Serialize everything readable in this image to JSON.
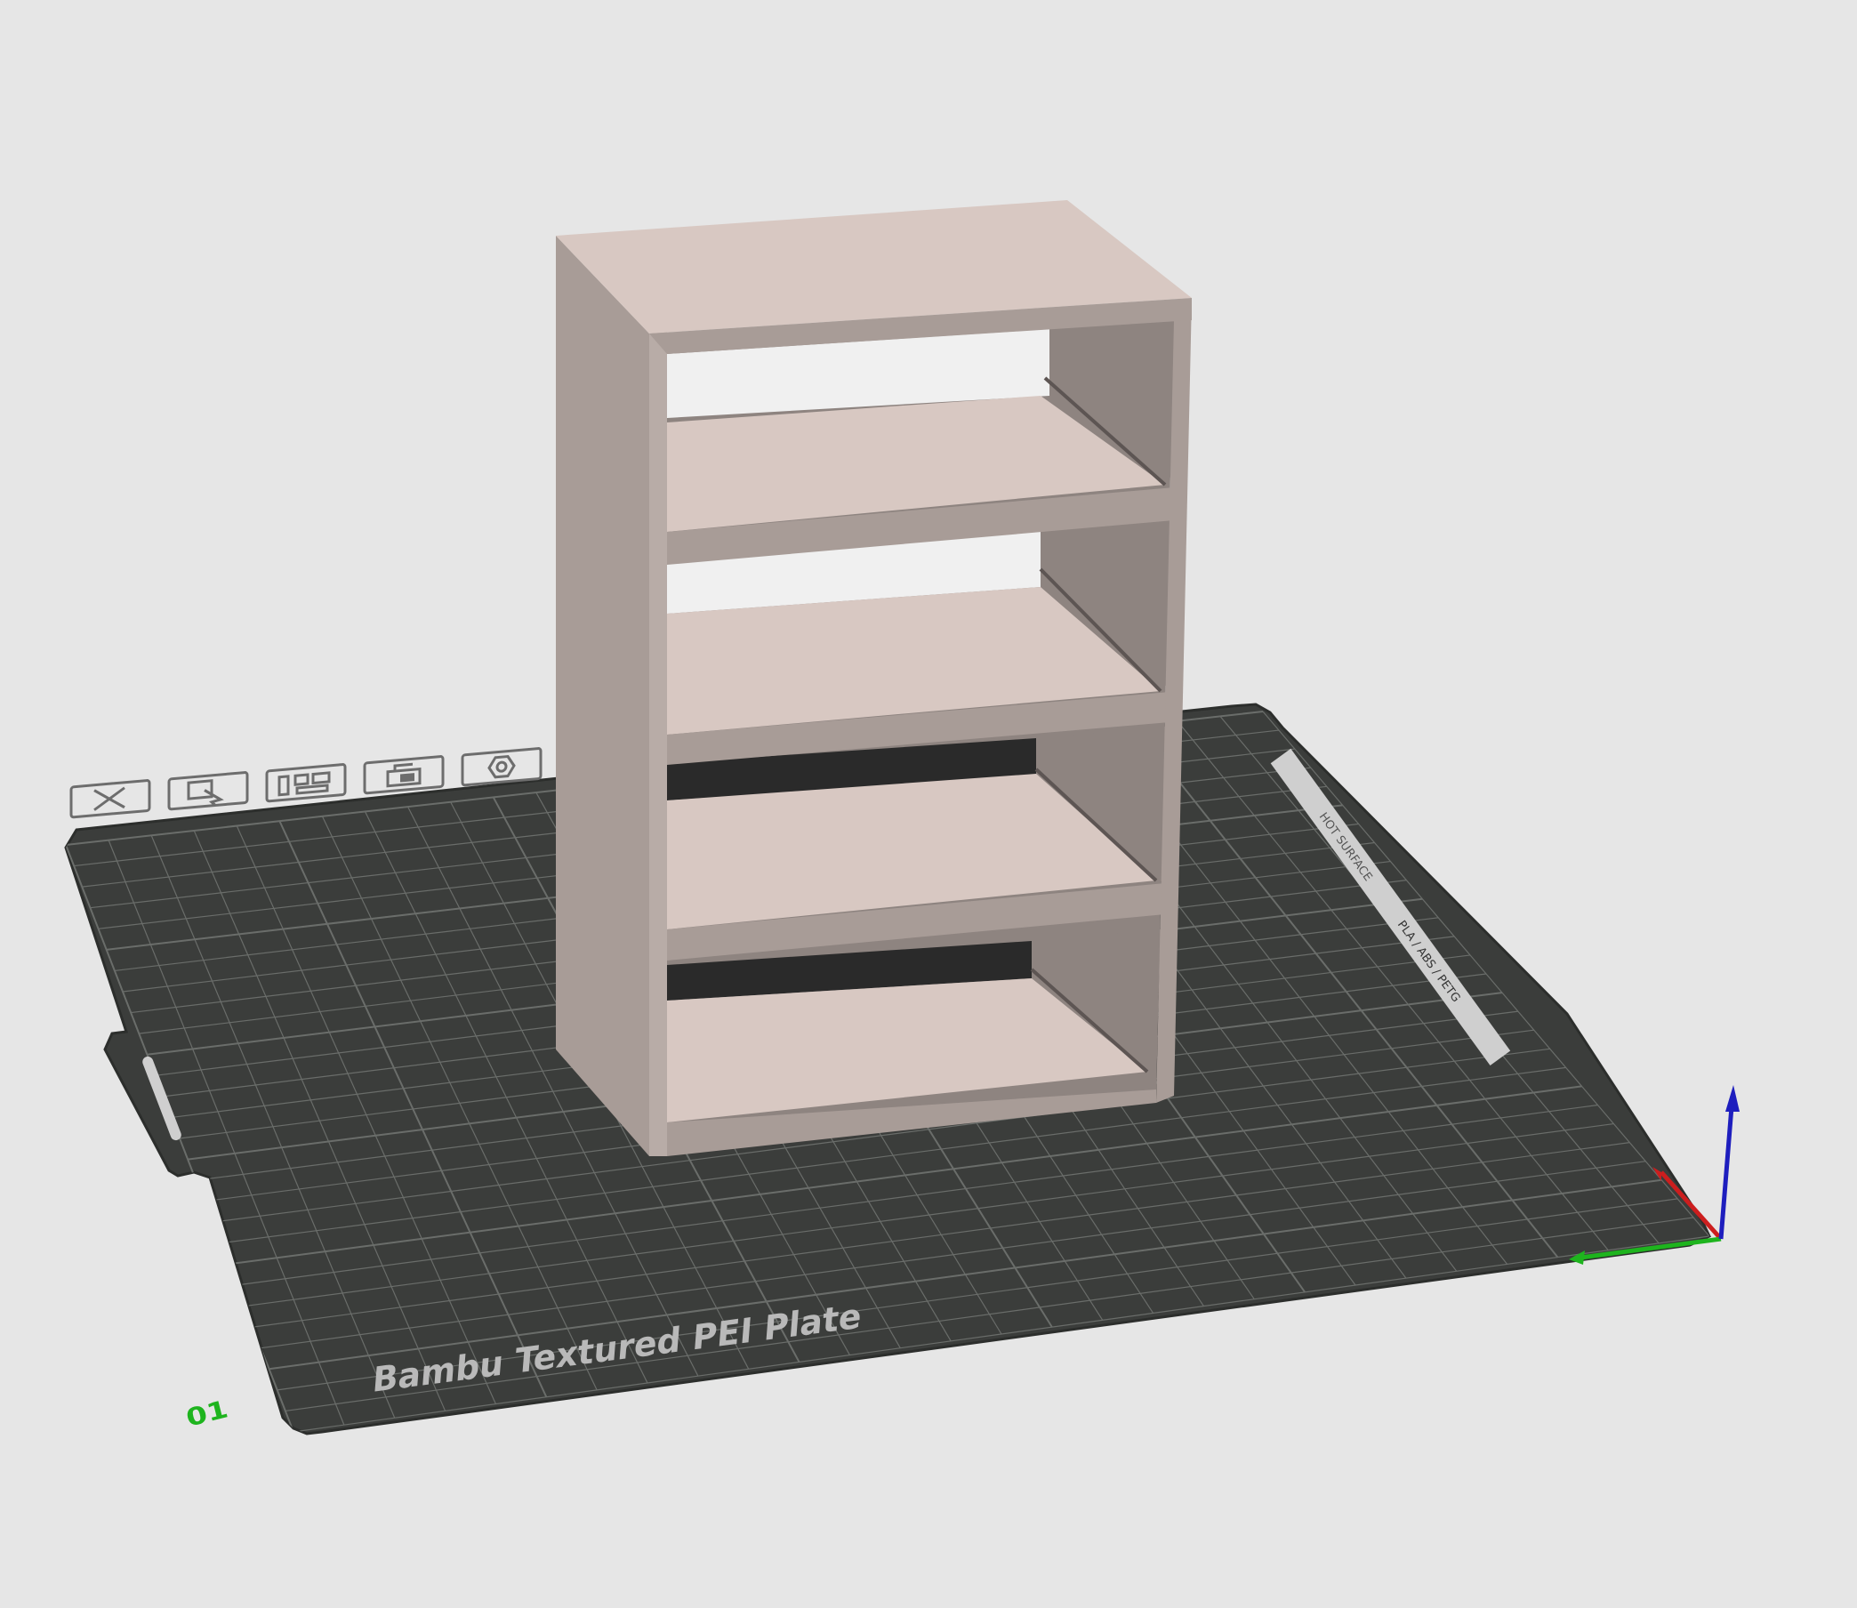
{
  "viewport": {
    "background": "#e6e6e6"
  },
  "plate": {
    "name": "Bambu Textured PEI Plate",
    "plate_number": "01",
    "side_label_top": "HOT SURFACE",
    "side_label_bottom": "PLA / ABS / PETG",
    "surface_color": "#3b3d3b",
    "grid_color": "#6a6d6a",
    "text_color": "#b9b9b9"
  },
  "plate_toolbar": {
    "buttons": [
      {
        "name": "delete-plate-button",
        "icon": "close-icon"
      },
      {
        "name": "pick-plate-button",
        "icon": "pick-icon"
      },
      {
        "name": "arrange-plate-button",
        "icon": "arrange-icon"
      },
      {
        "name": "lock-plate-button",
        "icon": "lock-icon"
      },
      {
        "name": "plate-settings-button",
        "icon": "gear-icon"
      }
    ]
  },
  "axes": {
    "x_color": "#cc1e1e",
    "y_color": "#1eb41e",
    "z_color": "#1e1ebe"
  },
  "model": {
    "name": "shelf-model",
    "color": "#d8c8c2",
    "shade_color": "#a89c97",
    "dark_color": "#8e8480"
  }
}
